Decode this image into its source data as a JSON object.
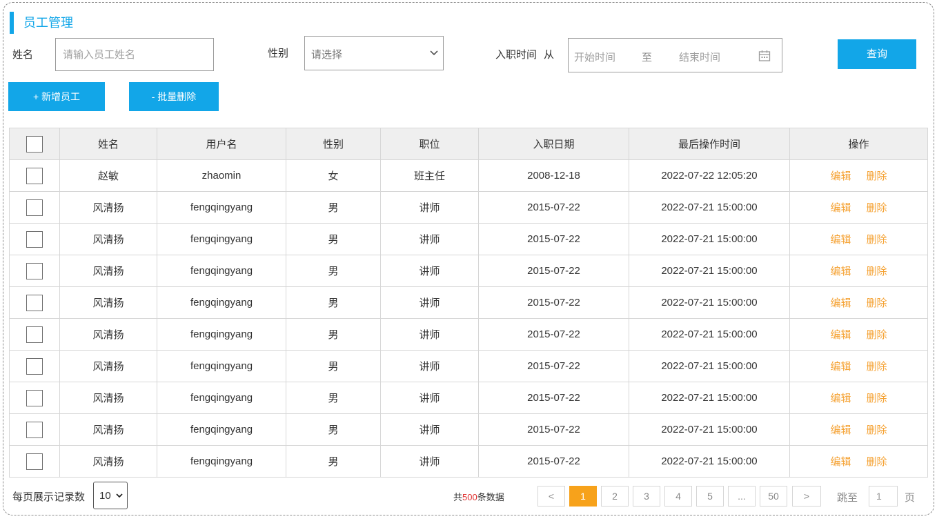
{
  "page": {
    "title": "员工管理"
  },
  "filters": {
    "name_label": "姓名",
    "name_placeholder": "请输入员工姓名",
    "gender_label": "性别",
    "gender_placeholder": "请选择",
    "hire_label": "入职时间",
    "from_label": "从",
    "start_placeholder": "开始时间",
    "to_label": "至",
    "end_placeholder": "结束时间",
    "query_button": "查询"
  },
  "actions": {
    "add_button": "+ 新增员工",
    "batch_delete_button": "- 批量删除"
  },
  "table": {
    "headers": [
      "姓名",
      "用户名",
      "性别",
      "职位",
      "入职日期",
      "最后操作时间",
      "操作"
    ],
    "edit_label": "编辑",
    "delete_label": "删除",
    "rows": [
      {
        "name": "赵敏",
        "username": "zhaomin",
        "gender": "女",
        "position": "班主任",
        "hire_date": "2008-12-18",
        "last_op": "2022-07-22 12:05:20"
      },
      {
        "name": "风清扬",
        "username": "fengqingyang",
        "gender": "男",
        "position": "讲师",
        "hire_date": "2015-07-22",
        "last_op": "2022-07-21 15:00:00"
      },
      {
        "name": "风清扬",
        "username": "fengqingyang",
        "gender": "男",
        "position": "讲师",
        "hire_date": "2015-07-22",
        "last_op": "2022-07-21 15:00:00"
      },
      {
        "name": "风清扬",
        "username": "fengqingyang",
        "gender": "男",
        "position": "讲师",
        "hire_date": "2015-07-22",
        "last_op": "2022-07-21 15:00:00"
      },
      {
        "name": "风清扬",
        "username": "fengqingyang",
        "gender": "男",
        "position": "讲师",
        "hire_date": "2015-07-22",
        "last_op": "2022-07-21 15:00:00"
      },
      {
        "name": "风清扬",
        "username": "fengqingyang",
        "gender": "男",
        "position": "讲师",
        "hire_date": "2015-07-22",
        "last_op": "2022-07-21 15:00:00"
      },
      {
        "name": "风清扬",
        "username": "fengqingyang",
        "gender": "男",
        "position": "讲师",
        "hire_date": "2015-07-22",
        "last_op": "2022-07-21 15:00:00"
      },
      {
        "name": "风清扬",
        "username": "fengqingyang",
        "gender": "男",
        "position": "讲师",
        "hire_date": "2015-07-22",
        "last_op": "2022-07-21 15:00:00"
      },
      {
        "name": "风清扬",
        "username": "fengqingyang",
        "gender": "男",
        "position": "讲师",
        "hire_date": "2015-07-22",
        "last_op": "2022-07-21 15:00:00"
      },
      {
        "name": "风清扬",
        "username": "fengqingyang",
        "gender": "男",
        "position": "讲师",
        "hire_date": "2015-07-22",
        "last_op": "2022-07-21 15:00:00"
      }
    ]
  },
  "pagination": {
    "page_size_label": "每页展示记录数",
    "page_size_value": "10",
    "total_prefix": "共",
    "total_count": "500",
    "total_suffix": "条数据",
    "prev": "<",
    "next": ">",
    "pages": [
      "1",
      "2",
      "3",
      "4",
      "5",
      "...",
      "50"
    ],
    "current_page": "1",
    "jump_label": "跳至",
    "jump_value": "1",
    "page_unit": "页"
  },
  "colors": {
    "accent": "#12a6e8",
    "action": "#f5a233",
    "active_page": "#f7a21b",
    "total_count": "#e0302f"
  },
  "icons": {
    "select_arrow": "chevron-down-icon",
    "date_picker": "calendar-icon"
  }
}
